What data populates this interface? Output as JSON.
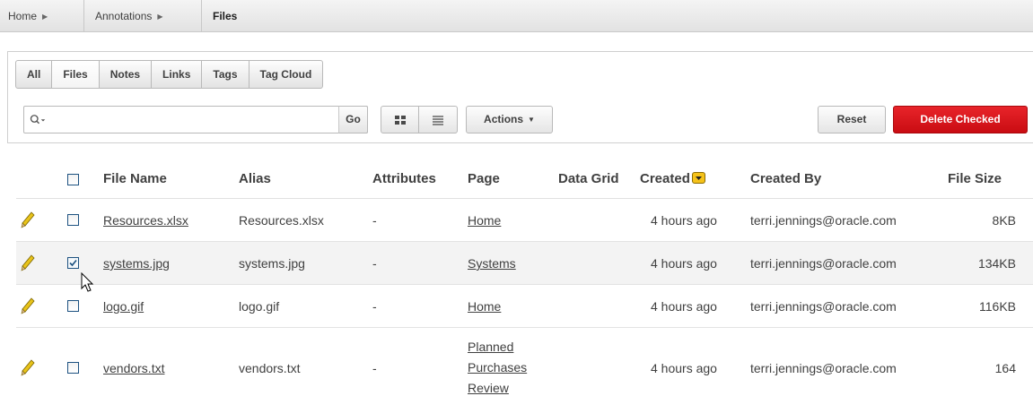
{
  "breadcrumb": {
    "items": [
      {
        "label": "Home"
      },
      {
        "label": "Annotations"
      }
    ],
    "current": "Files"
  },
  "tabs": [
    {
      "label": "All",
      "active": false
    },
    {
      "label": "Files",
      "active": true
    },
    {
      "label": "Notes",
      "active": false
    },
    {
      "label": "Links",
      "active": false
    },
    {
      "label": "Tags",
      "active": false
    },
    {
      "label": "Tag Cloud",
      "active": false
    }
  ],
  "toolbar": {
    "search_value": "",
    "search_icon": "search-icon",
    "go_label": "Go",
    "icon_view": "grid-view-icon",
    "report_view": "list-view-icon",
    "actions_label": "Actions",
    "reset_label": "Reset",
    "delete_label": "Delete Checked",
    "delete_color": "#d7141a"
  },
  "table": {
    "headers": {
      "file_name": "File Name",
      "alias": "Alias",
      "attributes": "Attributes",
      "page": "Page",
      "data_grid": "Data Grid",
      "created": "Created",
      "created_by": "Created By",
      "file_size": "File Size"
    },
    "sorted_by": "created",
    "rows": [
      {
        "file_name": "Resources.xlsx",
        "alias": "Resources.xlsx",
        "attributes": "-",
        "page": "Home",
        "page_line2": "",
        "page_line3": "",
        "data_grid": "",
        "created": "4 hours ago",
        "created_by": "terri.jennings@oracle.com",
        "file_size": "8KB",
        "checked": false
      },
      {
        "file_name": "systems.jpg",
        "alias": "systems.jpg",
        "attributes": "-",
        "page": "Systems",
        "page_line2": "",
        "page_line3": "",
        "data_grid": "",
        "created": "4 hours ago",
        "created_by": "terri.jennings@oracle.com",
        "file_size": "134KB",
        "checked": true
      },
      {
        "file_name": "logo.gif",
        "alias": "logo.gif",
        "attributes": "-",
        "page": "Home",
        "page_line2": "",
        "page_line3": "",
        "data_grid": "",
        "created": "4 hours ago",
        "created_by": "terri.jennings@oracle.com",
        "file_size": "116KB",
        "checked": false
      },
      {
        "file_name": "vendors.txt",
        "alias": "vendors.txt",
        "attributes": "-",
        "page": "Planned",
        "page_line2": "Purchases",
        "page_line3": "Review",
        "data_grid": "",
        "created": "4 hours ago",
        "created_by": "terri.jennings@oracle.com",
        "file_size": "164",
        "checked": false
      }
    ]
  }
}
